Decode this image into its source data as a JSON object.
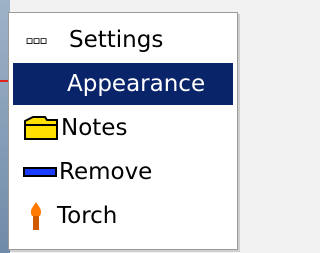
{
  "menu": {
    "items": [
      {
        "label": "Settings",
        "icon": "ellipsis-icon",
        "icon_text": "▫▫▫",
        "selected": false
      },
      {
        "label": "Appearance",
        "icon": "",
        "selected": true
      },
      {
        "label": "Notes",
        "icon": "folder-icon",
        "selected": false
      },
      {
        "label": "Remove",
        "icon": "dash-icon",
        "selected": false
      },
      {
        "label": "Torch",
        "icon": "torch-icon",
        "selected": false
      }
    ]
  },
  "colors": {
    "selection_bg": "#0a246a",
    "selection_fg": "#ffffff",
    "folder_yellow": "#ffe000",
    "remove_blue": "#1a3cff",
    "torch_orange": "#ff7a00",
    "arrow_red": "#e0201a"
  }
}
